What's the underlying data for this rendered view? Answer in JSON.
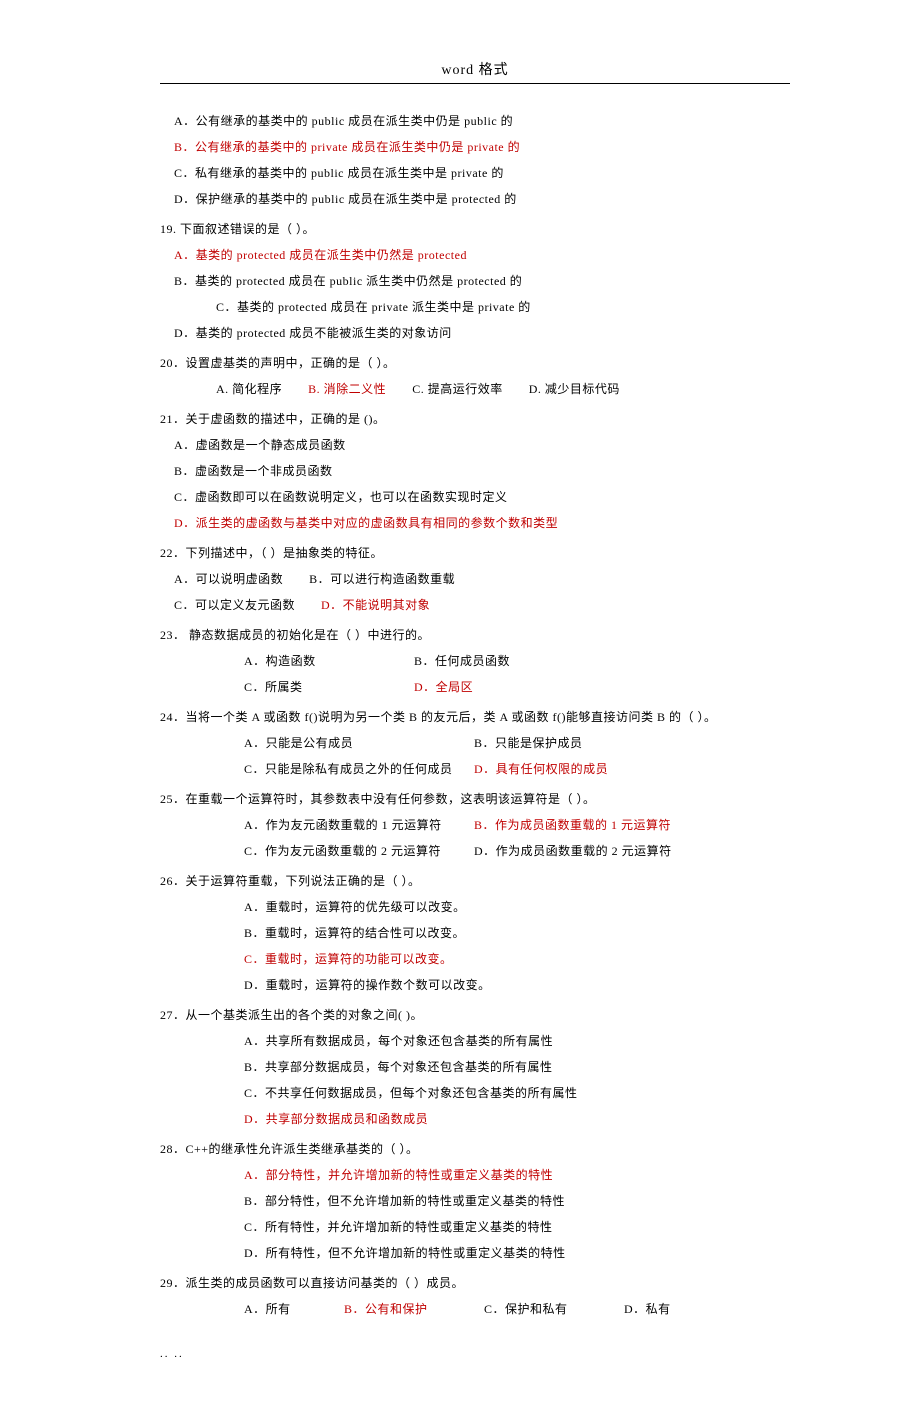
{
  "header": "word 格式",
  "footer": "..   ..",
  "pre_options": {
    "A": "A．公有继承的基类中的 public 成员在派生类中仍是 public 的",
    "B": "B．公有继承的基类中的 private 成员在派生类中仍是 private 的",
    "C": "C．私有继承的基类中的 public 成员在派生类中是 private 的",
    "D": "D．保护继承的基类中的 public 成员在派生类中是 protected 的"
  },
  "q19": {
    "stem": "19. 下面叙述错误的是（    ）。",
    "A": "A．基类的 protected 成员在派生类中仍然是 protected",
    "B": "B．基类的 protected 成员在 public 派生类中仍然是 protected 的",
    "C": "C．基类的 protected 成员在 private 派生类中是 private 的",
    "D": "D．基类的 protected 成员不能被派生类的对象访问"
  },
  "q20": {
    "stem": "20．设置虚基类的声明中，正确的是（    ）。",
    "A": "A. 简化程序",
    "B": "B. 消除二义性",
    "C": "C. 提高运行效率",
    "D": "D. 减少目标代码"
  },
  "q21": {
    "stem": "21．关于虚函数的描述中，正确的是 ()。",
    "A": "A．虚函数是一个静态成员函数",
    "B": "B．虚函数是一个非成员函数",
    "C": "C．虚函数即可以在函数说明定义，也可以在函数实现时定义",
    "D": "D．派生类的虚函数与基类中对应的虚函数具有相同的参数个数和类型"
  },
  "q22": {
    "stem": "22．下列描述中，（    ）是抽象类的特征。",
    "A": "A．可以说明虚函数",
    "B": "B．可以进行构造函数重载",
    "C": "C．可以定义友元函数",
    "D": "D．不能说明其对象"
  },
  "q23": {
    "stem": "23．  静态数据成员的初始化是在（    ）中进行的。",
    "A": "A．构造函数",
    "B": "B．任何成员函数",
    "C": "C．所属类",
    "D": "D．全局区"
  },
  "q24": {
    "stem": "24．当将一个类 A 或函数 f()说明为另一个类 B 的友元后，类 A 或函数 f()能够直接访问类 B 的（    ）。",
    "A": "A．只能是公有成员",
    "B": "B．只能是保护成员",
    "C": "C．只能是除私有成员之外的任何成员",
    "D": "D．具有任何权限的成员"
  },
  "q25": {
    "stem": "25．在重载一个运算符时，其参数表中没有任何参数，这表明该运算符是（    ）。",
    "A": "A．作为友元函数重载的 1 元运算符",
    "B": "B．作为成员函数重载的 1 元运算符",
    "C": "C．作为友元函数重载的 2 元运算符",
    "D": "D．作为成员函数重载的 2 元运算符"
  },
  "q26": {
    "stem": "26．关于运算符重载，下列说法正确的是（    ）。",
    "A": "A．重载时，运算符的优先级可以改变。",
    "B": "B．重载时，运算符的结合性可以改变。",
    "C": "C．重载时，运算符的功能可以改变。",
    "D": "D．重载时，运算符的操作数个数可以改变。"
  },
  "q27": {
    "stem": "27．从一个基类派生出的各个类的对象之间(    )。",
    "A": "A．共享所有数据成员，每个对象还包含基类的所有属性",
    "B": "B．共享部分数据成员，每个对象还包含基类的所有属性",
    "C": "C．不共享任何数据成员，但每个对象还包含基类的所有属性",
    "D": "D．共享部分数据成员和函数成员"
  },
  "q28": {
    "stem": "28．C++的继承性允许派生类继承基类的（    ）。",
    "A": "A．部分特性，并允许增加新的特性或重定义基类的特性",
    "B": "B．部分特性，但不允许增加新的特性或重定义基类的特性",
    "C": "C．所有特性，并允许增加新的特性或重定义基类的特性",
    "D": "D．所有特性，但不允许增加新的特性或重定义基类的特性"
  },
  "q29": {
    "stem": "29．派生类的成员函数可以直接访问基类的（    ）成员。",
    "A": "A．所有",
    "B": "B．公有和保护",
    "C": "C．保护和私有",
    "D": "D．私有"
  }
}
